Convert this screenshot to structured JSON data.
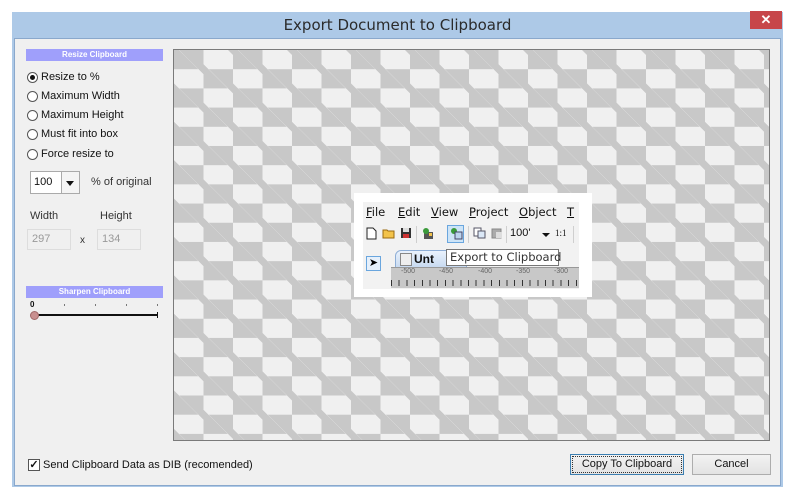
{
  "window": {
    "title": "Export Document to Clipboard",
    "close_glyph": "✕"
  },
  "resize": {
    "header": "Resize Clipboard",
    "options": [
      {
        "label": "Resize to %",
        "selected": true
      },
      {
        "label": "Maximum Width",
        "selected": false
      },
      {
        "label": "Maximum Height",
        "selected": false
      },
      {
        "label": "Must fit into box",
        "selected": false
      },
      {
        "label": "Force resize to",
        "selected": false
      }
    ],
    "percent_value": "100",
    "percent_suffix": "% of original",
    "width_label": "Width",
    "height_label": "Height",
    "width_value": "297",
    "height_value": "134",
    "times_symbol": "x"
  },
  "sharpen": {
    "header": "Sharpen Clipboard",
    "value_label": "0",
    "value": 0
  },
  "preview": {
    "menu": [
      {
        "underline": "F",
        "rest": "ile"
      },
      {
        "underline": "E",
        "rest": "dit"
      },
      {
        "underline": "V",
        "rest": "iew"
      },
      {
        "underline": "P",
        "rest": "roject"
      },
      {
        "underline": "O",
        "rest": "bject"
      },
      {
        "underline": "T",
        "rest": ""
      }
    ],
    "toolbar_icons": [
      "new-icon",
      "open-icon",
      "save-icon",
      "export-icon",
      "export-clipboard-icon",
      "copy-icon",
      "paste-icon"
    ],
    "zoom_value": "100'",
    "ratio_label": "1:1",
    "tab_label": "Unt",
    "ruler_labels": [
      "-500",
      "-450",
      "-400",
      "-350",
      "-300"
    ],
    "tooltip": "Export to Clipboard"
  },
  "footer": {
    "dib_checkbox_label": "Send Clipboard Data as DIB (recomended)",
    "dib_checked": true,
    "copy_button": "Copy To Clipboard",
    "cancel_button": "Cancel"
  }
}
